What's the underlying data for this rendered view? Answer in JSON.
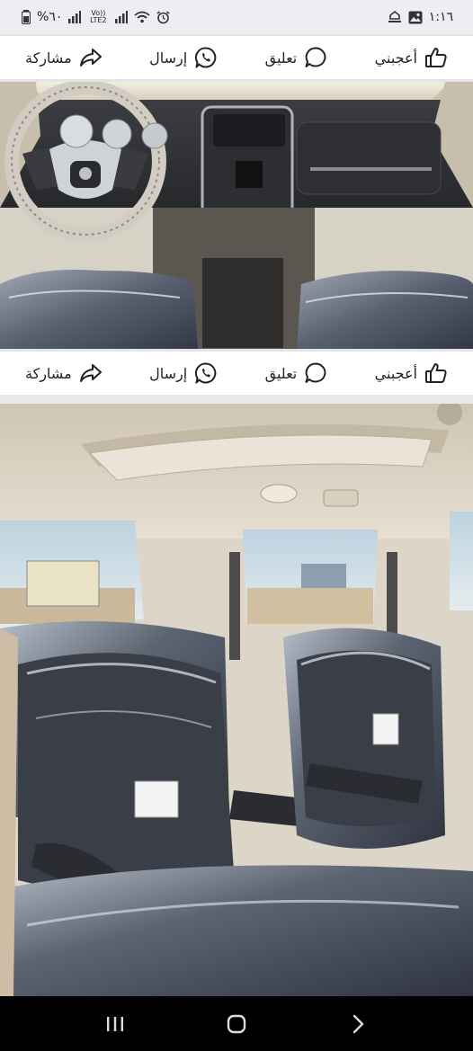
{
  "status_bar": {
    "battery_text": "%٦٠",
    "network_small": "Vo)) LTE2",
    "time": "١:١٦"
  },
  "posts": [
    {
      "actions": {
        "share_label": "مشاركة",
        "send_label": "إرسال",
        "comment_label": "تعليق",
        "like_label": "أعجبني"
      }
    },
    {
      "actions": {
        "share_label": "مشاركة",
        "send_label": "إرسال",
        "comment_label": "تعليق",
        "like_label": "أعجبني"
      }
    }
  ],
  "colors": {
    "action_bar_bg": "#ffffff",
    "feed_bg": "#e9eaee",
    "nav_bar_bg": "#000000"
  },
  "icons": {
    "share": "share-arrow-icon",
    "send": "whatsapp-icon",
    "comment": "comment-bubble-icon",
    "like": "thumbs-up-icon"
  }
}
